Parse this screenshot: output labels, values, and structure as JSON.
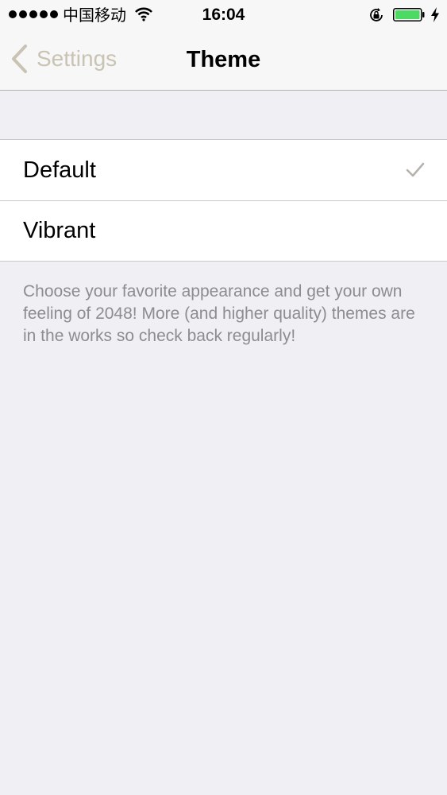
{
  "status_bar": {
    "carrier": "中国移动",
    "time": "16:04",
    "signal_icon": "signal-dots-icon",
    "wifi_icon": "wifi-icon",
    "lock_icon": "rotation-lock-icon",
    "battery_icon": "battery-icon",
    "charging_icon": "charging-bolt-icon",
    "battery_color": "#4cd964"
  },
  "nav": {
    "back_label": "Settings",
    "title": "Theme",
    "accent_color": "#c9c3b3"
  },
  "themes": {
    "items": [
      {
        "label": "Default",
        "selected": true
      },
      {
        "label": "Vibrant",
        "selected": false
      }
    ],
    "footer": "Choose your favorite appearance and get your own feeling of 2048! More (and higher quality) themes are in the works so check back regularly!"
  }
}
